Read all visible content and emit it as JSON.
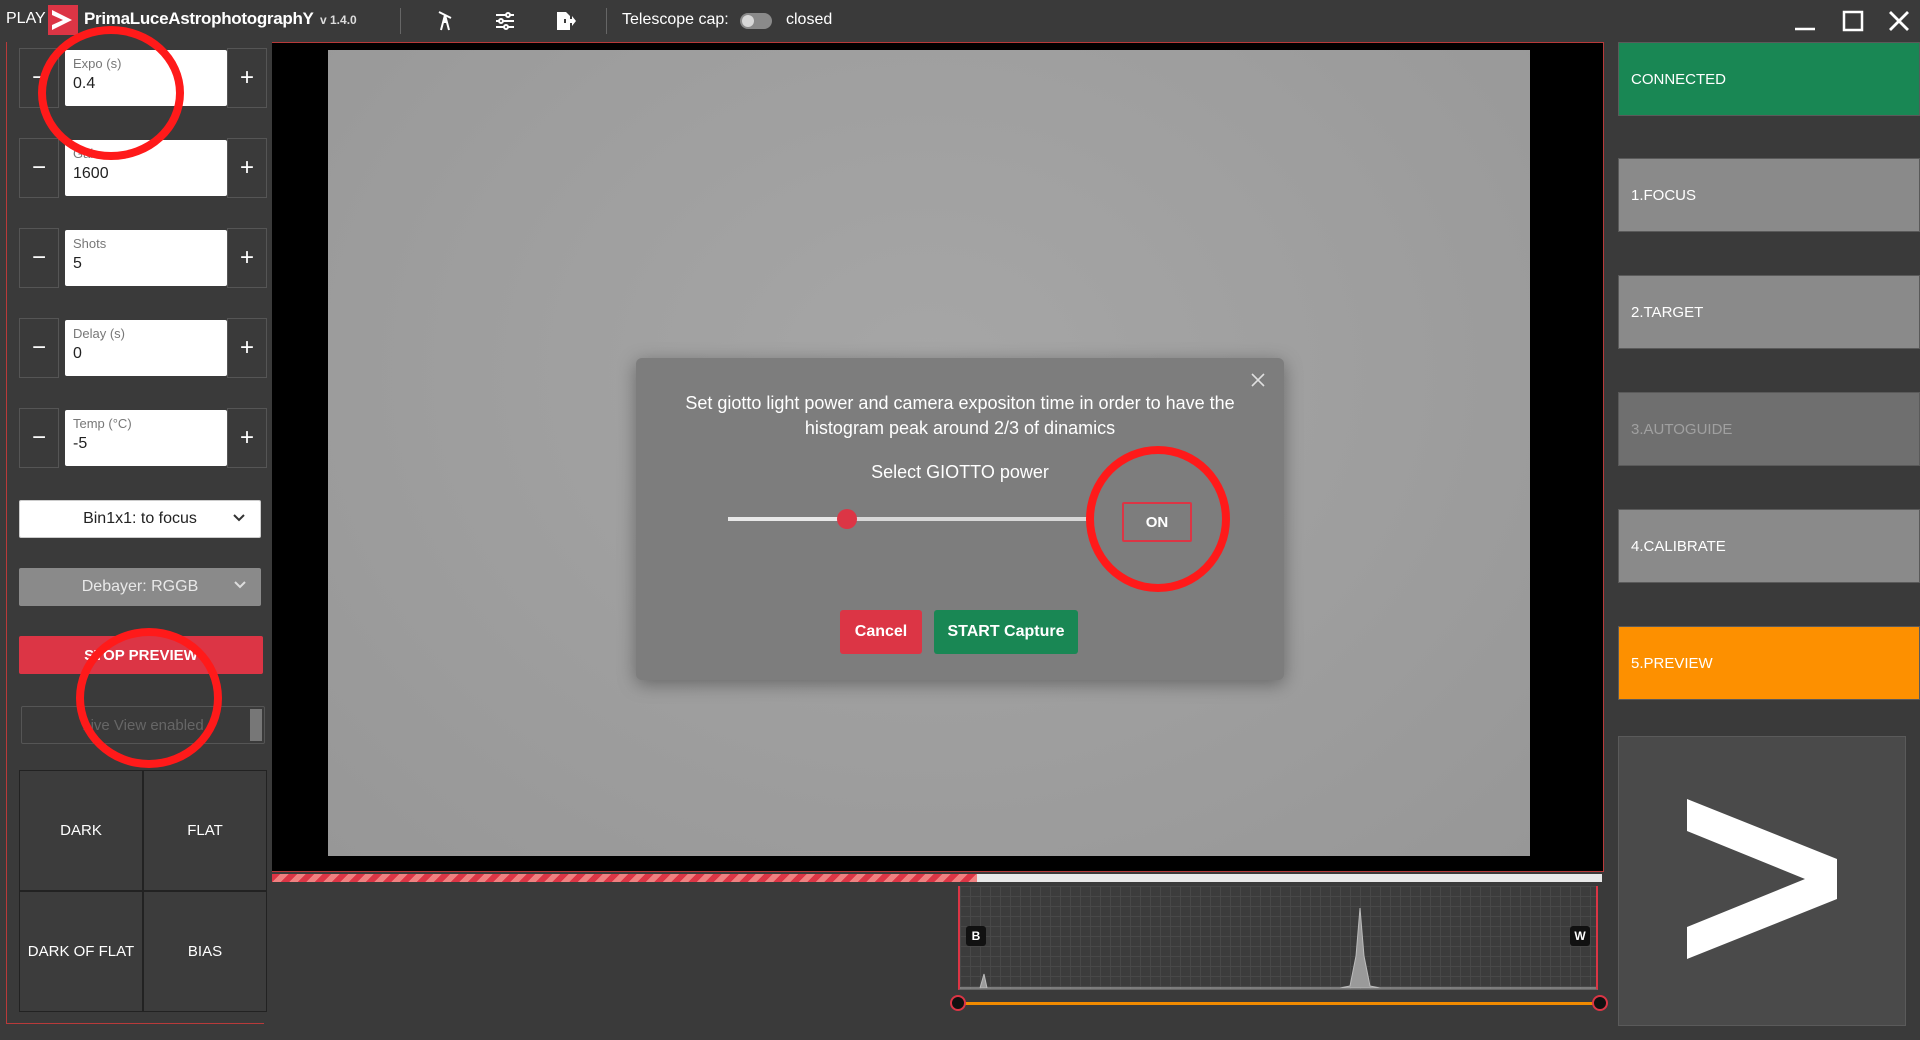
{
  "titlebar": {
    "play_label": "PLAY",
    "app_name": "PrimaLuceAstrophotographY",
    "version": "v 1.4.0",
    "telescope_cap_label": "Telescope cap:",
    "telescope_cap_state": "closed",
    "icons": [
      "telescope-icon",
      "sliders-icon",
      "export-icon"
    ],
    "window_controls": [
      "minimize-icon",
      "maximize-icon",
      "close-icon"
    ]
  },
  "left_panel": {
    "steppers": [
      {
        "label": "Expo (s)",
        "value": "0.4"
      },
      {
        "label": "Gain",
        "value": "1600"
      },
      {
        "label": "Shots",
        "value": "5"
      },
      {
        "label": "Delay (s)",
        "value": "0"
      },
      {
        "label": "Temp (°C)",
        "value": "-5"
      }
    ],
    "minus_symbol": "−",
    "plus_symbol": "+",
    "binning_select": "Bin1x1: to focus",
    "debayer_select": "Debayer: RGGB",
    "stop_preview_label": "STOP PREVIEW",
    "live_view_label": "Live View enabled",
    "calibration_buttons": [
      "DARK",
      "FLAT",
      "DARK OF FLAT",
      "BIAS"
    ]
  },
  "viewer": {
    "progress": 0.53
  },
  "histogram": {
    "black_tag": "B",
    "white_tag": "W",
    "peak_position": 0.64
  },
  "right_panel": {
    "steps": [
      "CONNECTED",
      "1.FOCUS",
      "2.TARGET",
      "3.AUTOGUIDE",
      "4.CALIBRATE",
      "5.PREVIEW"
    ],
    "next_icon": "chevron-right-icon"
  },
  "modal": {
    "message": "Set giotto light power and camera expositon time in order to have the histogram peak around 2/3 of dinamics",
    "power_label": "Select GIOTTO power",
    "power_level": 0.33,
    "on_label": "ON",
    "cancel_label": "Cancel",
    "start_label": "START Capture"
  },
  "colors": {
    "danger": "#dc3545",
    "success": "#198754",
    "warning": "#fd9000",
    "annotation": "#ff1a1a"
  }
}
